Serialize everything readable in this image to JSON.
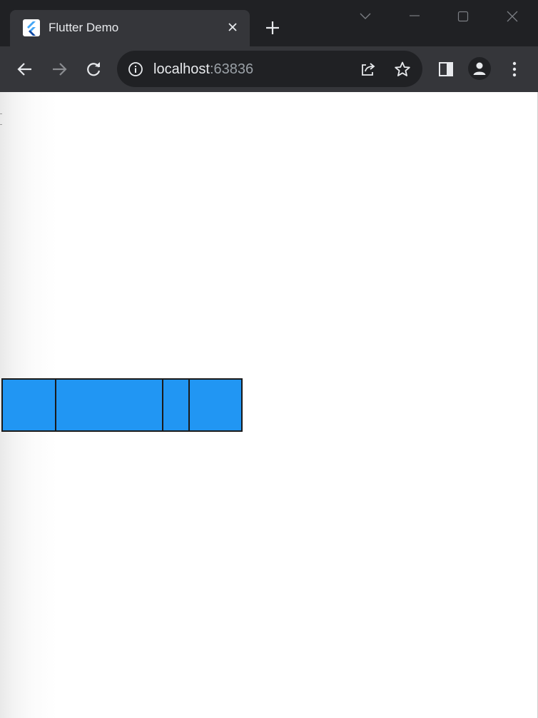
{
  "browser": {
    "tab": {
      "title": "Flutter Demo",
      "favicon": "flutter-logo-icon"
    },
    "address_bar": {
      "host": "localhost",
      "port": ":63836"
    },
    "icons": {
      "close_tab": "close-icon",
      "new_tab": "plus-icon",
      "tab_search": "chevron-down-icon",
      "minimize": "minimize-icon",
      "maximize": "maximize-icon",
      "close_window": "close-window-icon",
      "back": "back-arrow-icon",
      "forward": "forward-arrow-icon",
      "reload": "reload-icon",
      "site_info": "info-icon",
      "share": "share-icon",
      "bookmark": "star-icon",
      "side_panel": "side-panel-icon",
      "profile": "profile-avatar-icon",
      "menu": "kebab-menu-icon"
    },
    "colors": {
      "tabstrip_bg": "#202124",
      "toolbar_bg": "#35363a",
      "text_primary": "#e8eaed",
      "text_secondary": "#9aa0a6"
    }
  },
  "page": {
    "background": "#ffffff",
    "blocks": {
      "fill_color": "#2196f3",
      "border_color": "#1a1a1a",
      "count": 4
    }
  }
}
